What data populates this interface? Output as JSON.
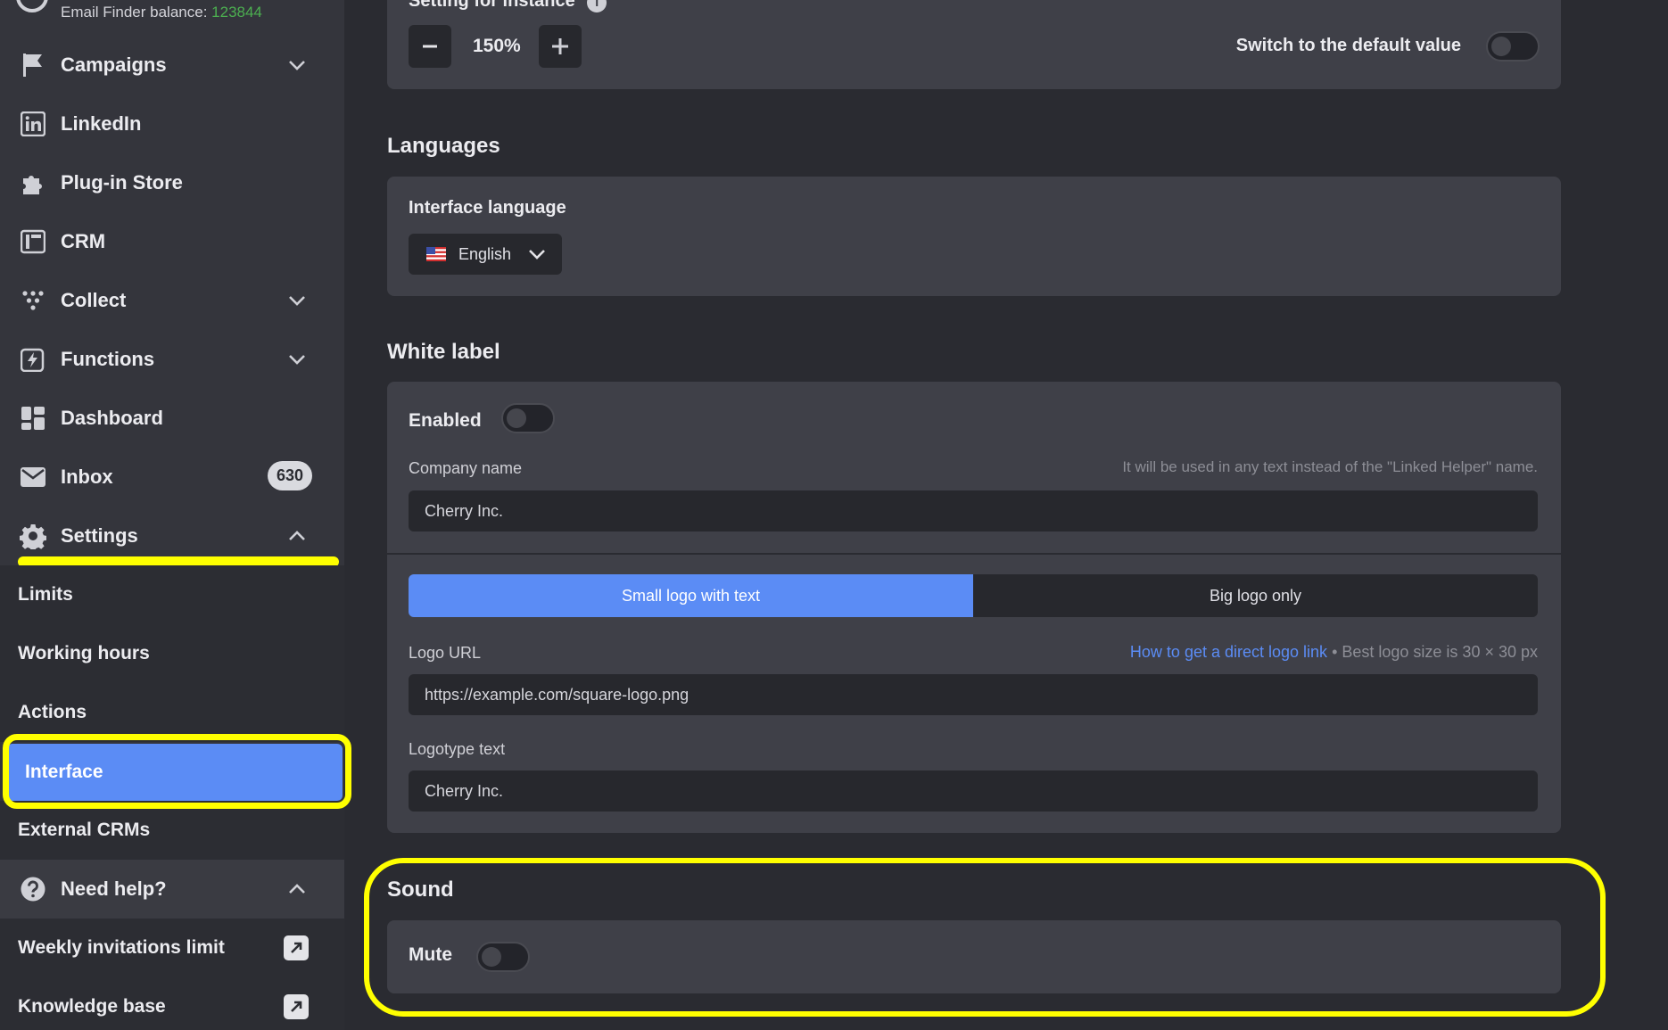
{
  "sidebar": {
    "balance_label": "Email Finder balance:",
    "balance_value": "123844",
    "items": [
      {
        "label": "Campaigns"
      },
      {
        "label": "LinkedIn"
      },
      {
        "label": "Plug-in Store"
      },
      {
        "label": "CRM"
      },
      {
        "label": "Collect"
      },
      {
        "label": "Functions"
      },
      {
        "label": "Dashboard"
      },
      {
        "label": "Inbox",
        "badge": "630"
      },
      {
        "label": "Settings"
      }
    ],
    "settings_sub": [
      {
        "label": "Limits"
      },
      {
        "label": "Working hours"
      },
      {
        "label": "Actions"
      },
      {
        "label": "Interface"
      },
      {
        "label": "External CRMs"
      }
    ],
    "help": {
      "label": "Need help?",
      "links": [
        {
          "label": "Weekly invitations limit"
        },
        {
          "label": "Knowledge base"
        }
      ]
    }
  },
  "main": {
    "zoom": {
      "setting_label": "Setting for instance",
      "value": "150%",
      "default_label": "Switch to the default value"
    },
    "languages": {
      "title": "Languages",
      "interface_label": "Interface language",
      "selected": "English"
    },
    "white_label": {
      "title": "White label",
      "enabled_label": "Enabled",
      "company_label": "Company name",
      "company_hint": "It will be used in any text instead of the \"Linked Helper\" name.",
      "company_value": "Cherry Inc.",
      "logo_options": [
        "Small logo with text",
        "Big logo only"
      ],
      "logo_url_label": "Logo URL",
      "logo_link_text": "How to get a direct logo link",
      "logo_size_hint": "• Best logo size is 30 × 30 px",
      "logo_url_value": "https://example.com/square-logo.png",
      "logotype_label": "Logotype text",
      "logotype_value": "Cherry Inc."
    },
    "sound": {
      "title": "Sound",
      "mute_label": "Mute"
    }
  },
  "colors": {
    "accent": "#5b8cf5",
    "highlight": "#ffff00",
    "balance": "#4caf50"
  }
}
